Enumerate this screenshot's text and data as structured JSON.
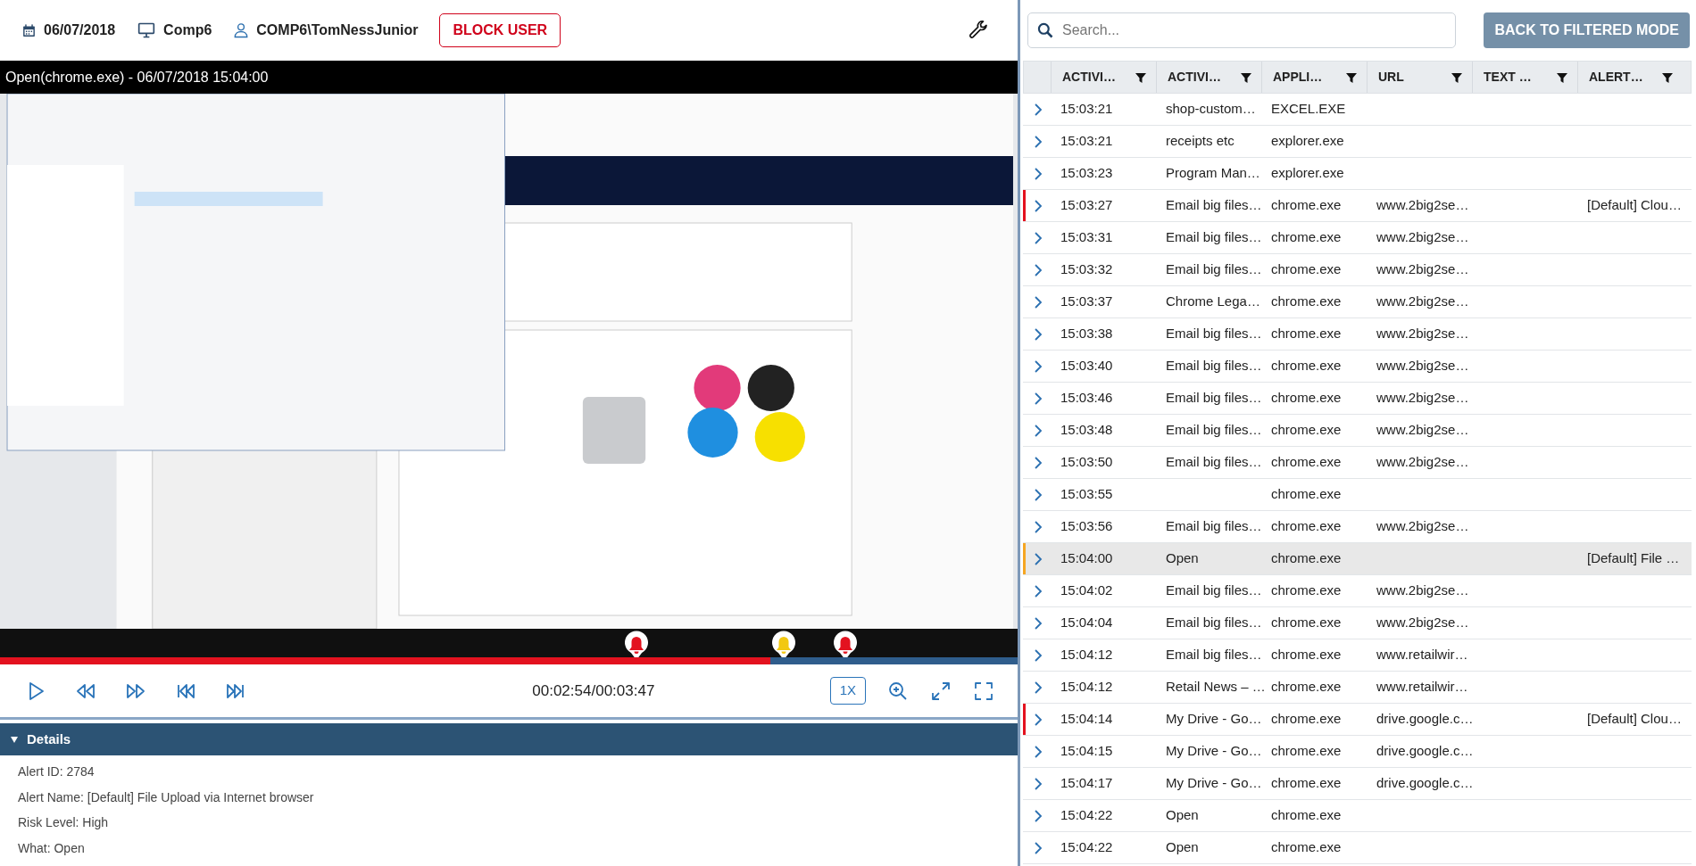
{
  "header": {
    "date": "06/07/2018",
    "computer": "Comp6",
    "user": "COMP6\\TomNessJunior",
    "block_button": "BLOCK USER"
  },
  "player": {
    "title": "Open(chrome.exe) - 06/07/2018 15:04:00",
    "progress": {
      "level": 0.757
    },
    "markers": [
      {
        "level": 0.625,
        "color": "#e3121f"
      },
      {
        "level": 0.77,
        "color": "#f2c811"
      },
      {
        "level": 0.831,
        "color": "#e3121f"
      }
    ],
    "time": "00:02:54/00:03:47",
    "speed": "1X"
  },
  "details": {
    "title": "Details",
    "expanded": true,
    "lines": [
      "Alert ID: 2784",
      "Alert Name: [Default] File Upload via Internet browser",
      "Risk Level: High",
      "What: Open"
    ]
  },
  "search": {
    "placeholder": "Search..."
  },
  "back_button": "BACK TO FILTERED MODE",
  "table": {
    "columns": [
      "ACTIVI…",
      "ACTIVI…",
      "APPLI…",
      "URL",
      "TEXT …",
      "ALERT…"
    ],
    "rows": [
      {
        "time": "15:03:21",
        "activity": "shop-custom…",
        "application": "EXCEL.EXE",
        "selected": false
      },
      {
        "time": "15:03:21",
        "activity": "receipts etc",
        "application": "explorer.exe",
        "selected": false
      },
      {
        "time": "15:03:23",
        "activity": "Program Man…",
        "application": "explorer.exe",
        "selected": false
      },
      {
        "time": "15:03:27",
        "activity": "Email big files…",
        "application": "chrome.exe",
        "url": "www.2big2se…",
        "alert": "[Default] Clou…",
        "selected": false,
        "color": "#e3121f"
      },
      {
        "time": "15:03:31",
        "activity": "Email big files…",
        "application": "chrome.exe",
        "url": "www.2big2se…",
        "selected": false
      },
      {
        "time": "15:03:32",
        "activity": "Email big files…",
        "application": "chrome.exe",
        "url": "www.2big2se…",
        "selected": false
      },
      {
        "time": "15:03:37",
        "activity": "Chrome Lega…",
        "application": "chrome.exe",
        "url": "www.2big2se…",
        "selected": false
      },
      {
        "time": "15:03:38",
        "activity": "Email big files…",
        "application": "chrome.exe",
        "url": "www.2big2se…",
        "selected": false
      },
      {
        "time": "15:03:40",
        "activity": "Email big files…",
        "application": "chrome.exe",
        "url": "www.2big2se…",
        "selected": false
      },
      {
        "time": "15:03:46",
        "activity": "Email big files…",
        "application": "chrome.exe",
        "url": "www.2big2se…",
        "selected": false
      },
      {
        "time": "15:03:48",
        "activity": "Email big files…",
        "application": "chrome.exe",
        "url": "www.2big2se…",
        "selected": false
      },
      {
        "time": "15:03:50",
        "activity": "Email big files…",
        "application": "chrome.exe",
        "url": "www.2big2se…",
        "selected": false
      },
      {
        "time": "15:03:55",
        "application": "chrome.exe",
        "selected": false
      },
      {
        "time": "15:03:56",
        "activity": "Email big files…",
        "application": "chrome.exe",
        "url": "www.2big2se…",
        "selected": false
      },
      {
        "time": "15:04:00",
        "activity": "Open",
        "application": "chrome.exe",
        "alert": "[Default] File …",
        "selected": true,
        "color": "#f5a623"
      },
      {
        "time": "15:04:02",
        "activity": "Email big files…",
        "application": "chrome.exe",
        "url": "www.2big2se…",
        "selected": false
      },
      {
        "time": "15:04:04",
        "activity": "Email big files…",
        "application": "chrome.exe",
        "url": "www.2big2se…",
        "selected": false
      },
      {
        "time": "15:04:12",
        "activity": "Email big files…",
        "application": "chrome.exe",
        "url": "www.retailwir…",
        "selected": false
      },
      {
        "time": "15:04:12",
        "activity": "Retail News – …",
        "application": "chrome.exe",
        "url": "www.retailwir…",
        "selected": false
      },
      {
        "time": "15:04:14",
        "activity": "My Drive - Go…",
        "application": "chrome.exe",
        "url": "drive.google.c…",
        "alert": "[Default] Clou…",
        "selected": false,
        "color": "#e3121f"
      },
      {
        "time": "15:04:15",
        "activity": "My Drive - Go…",
        "application": "chrome.exe",
        "url": "drive.google.c…",
        "selected": false
      },
      {
        "time": "15:04:17",
        "activity": "My Drive - Go…",
        "application": "chrome.exe",
        "url": "drive.google.c…",
        "selected": false
      },
      {
        "time": "15:04:22",
        "activity": "Open",
        "application": "chrome.exe",
        "selected": false
      },
      {
        "time": "15:04:22",
        "activity": "Open",
        "application": "chrome.exe",
        "selected": false
      }
    ]
  }
}
